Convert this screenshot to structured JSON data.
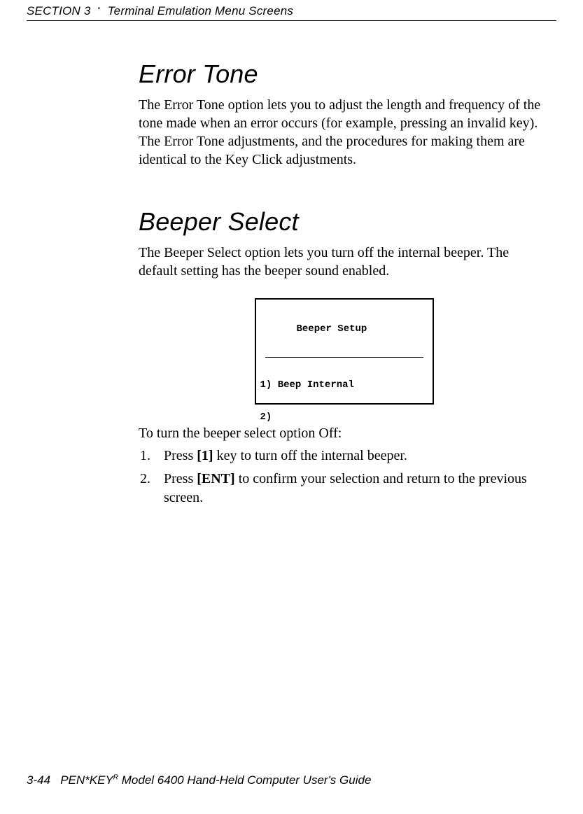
{
  "header": {
    "section": "SECTION 3",
    "separator": "\"",
    "title": "Terminal Emulation Menu Screens"
  },
  "section1": {
    "heading": "Error Tone",
    "paragraph": "The Error Tone option lets you to adjust the length and frequency of the tone made when an error occurs (for example, pressing an invalid key).  The Error Tone adjustments, and the procedures for making them are identical to the Key Click adjustments."
  },
  "section2": {
    "heading": "Beeper Select",
    "paragraph": "The Beeper Select option lets you turn off the internal beeper.  The default setting has the beeper sound enabled."
  },
  "screen": {
    "title": "Beeper Setup",
    "line1": "1) Beep Internal",
    "line2": "2)"
  },
  "instructions": {
    "intro": "To turn the beeper select option Off:",
    "step1_pre": "Press ",
    "step1_key": "[1]",
    "step1_post": " key to turn off the internal beeper.",
    "step2_pre": "Press ",
    "step2_key": "[ENT]",
    "step2_post": " to confirm your selection and return to the previous screen."
  },
  "footer": {
    "page": "3-44",
    "brand_pre": "PEN*KEY",
    "brand_sup": "R",
    "brand_post": " Model 6400 Hand-Held Computer User's Guide"
  }
}
